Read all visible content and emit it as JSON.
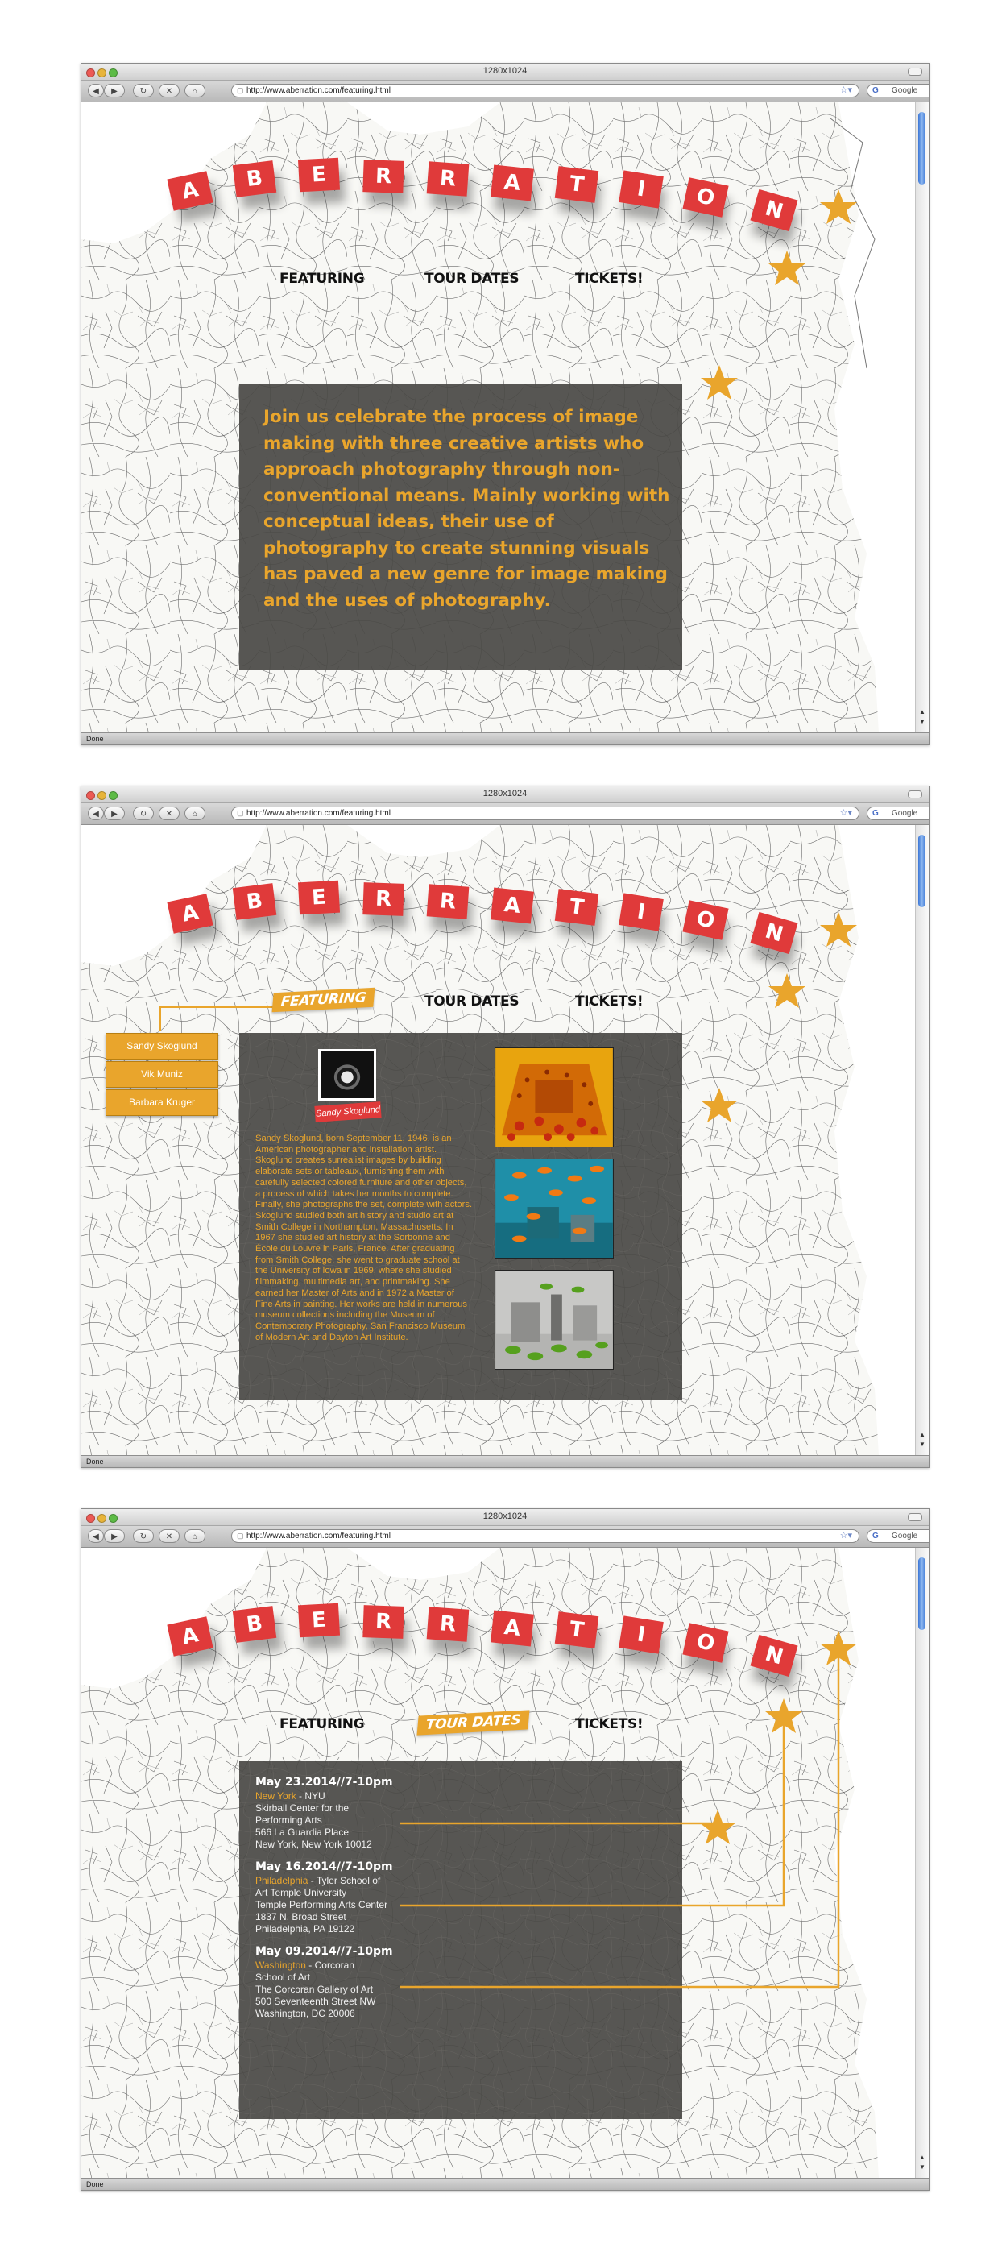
{
  "browser": {
    "window_title": "1280x1024",
    "url": "http://www.aberration.com/featuring.html",
    "search_placeholder": "Google",
    "status_text": "Done",
    "nav_buttons": [
      "◀",
      "▶",
      "↻",
      "✕",
      "⌂"
    ]
  },
  "site": {
    "banner_letters": [
      "A",
      "B",
      "E",
      "R",
      "R",
      "A",
      "T",
      "I",
      "O",
      "N"
    ],
    "nav": {
      "featuring": "FEATURING",
      "tour_dates": "TOUR DATES",
      "tickets": "TICKETS!"
    },
    "intro_text": "Join us celebrate the process of image making with three creative artists who approach photography through non-conventional means. Mainly working with conceptual ideas, their use of photography to create stunning visuals has paved a new genre for image making and the uses of photography.",
    "artists": [
      "Sandy Skoglund",
      "Vik Muniz",
      "Barbara Kruger"
    ],
    "featured": {
      "name": "Sandy Skoglund",
      "bio": "Sandy Skoglund, born September 11, 1946, is an American photographer and installation artist. Skoglund creates surrealist images by building elaborate sets or tableaux, furnishing them with carefully selected colored furniture and other objects, a process of which takes her months to complete. Finally, she photographs the set, complete with actors. Skoglund studied both art history and studio art at Smith College in Northampton, Massachusetts. In 1967 she studied art history at the Sorbonne and École du Louvre in Paris, France. After graduating from Smith College, she went to graduate school at the University of Iowa in 1969, where she studied filmmaking, multimedia art, and printmaking. She earned her Master of Arts and in 1972 a Master of Fine Arts in painting. Her works are held in numerous museum collections including the Museum of Contemporary Photography, San Francisco Museum of Modern Art and Dayton Art Institute."
    },
    "tour_dates": [
      {
        "date": "May 23.2014//7-10pm",
        "city": "New York",
        "venue": " - NYU",
        "lines": [
          "Skirball Center for the",
          "Performing Arts",
          "566 La Guardia Place",
          "New York, New York 10012"
        ]
      },
      {
        "date": "May 16.2014//7-10pm",
        "city": "Philadelphia",
        "venue": " - Tyler School of",
        "lines": [
          "Art Temple University",
          "Temple Performing Arts Center",
          "1837 N. Broad Street",
          "Philadelphia, PA 19122"
        ]
      },
      {
        "date": "May 09.2014//7-10pm",
        "city": "Washington",
        "venue": " - Corcoran",
        "lines": [
          "School of Art",
          "The Corcoran Gallery of Art",
          "500 Seventeenth Street NW",
          "Washington, DC 20006"
        ]
      }
    ]
  },
  "colors": {
    "accent": "#e9a52c",
    "banner_red": "#e03a3a",
    "panel": "#4a4946"
  }
}
